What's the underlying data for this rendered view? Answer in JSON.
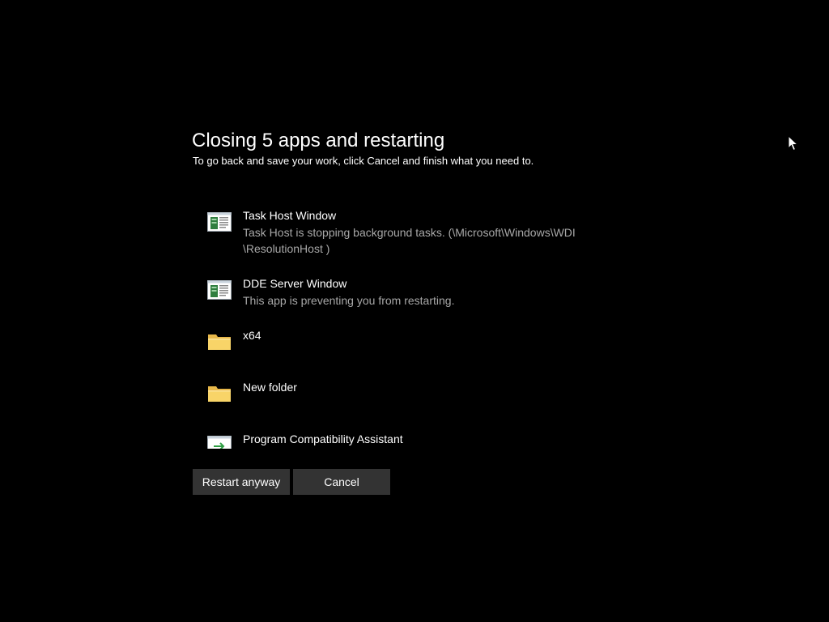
{
  "dialog": {
    "title": "Closing 5 apps and restarting",
    "subtitle": "To go back and save your work, click Cancel and finish what you need to."
  },
  "apps": [
    {
      "name": "Task Host Window",
      "description": "Task Host is stopping background tasks. (\\Microsoft\\Windows\\WDI \\ResolutionHost )",
      "icon": "window-app-icon"
    },
    {
      "name": "DDE Server Window",
      "description": "This app is preventing you from restarting.",
      "icon": "window-app-icon"
    },
    {
      "name": "x64",
      "description": "",
      "icon": "folder-icon"
    },
    {
      "name": "New folder",
      "description": "",
      "icon": "folder-icon"
    },
    {
      "name": "Program Compatibility Assistant",
      "description": "",
      "icon": "compatibility-assistant-icon"
    }
  ],
  "buttons": {
    "restart_label": "Restart anyway",
    "cancel_label": "Cancel"
  },
  "colors": {
    "background": "#000000",
    "button": "#333333",
    "secondary_text": "#a8a8a8",
    "folder": "#f8d468"
  }
}
